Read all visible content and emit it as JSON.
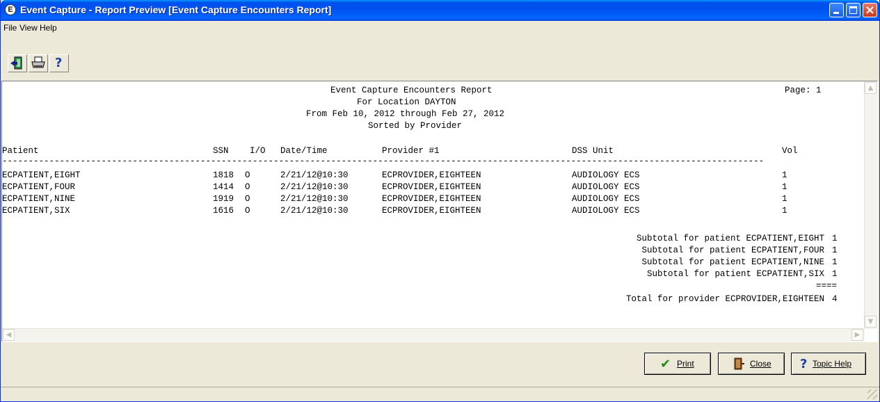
{
  "window": {
    "title": "Event Capture - Report Preview [Event Capture Encounters Report]",
    "app_icon_glyph": "E"
  },
  "menu": [
    "File",
    "View",
    "Help"
  ],
  "toolbar": {
    "buttons": [
      "exit-icon",
      "print-icon",
      "help-icon"
    ],
    "help_glyph": "?"
  },
  "report": {
    "header_lines": [
      "Event Capture Encounters Report",
      "For Location DAYTON",
      "From Feb 10, 2012 through Feb 27, 2012",
      "Sorted by Provider"
    ],
    "page_label": "Page: 1",
    "columns": [
      "Patient",
      "SSN",
      "I/O",
      "Date/Time",
      "Provider #1",
      "DSS Unit",
      "Vol"
    ],
    "rule": "--------------------------------------------------------------------------------------------------------------------------------------------------",
    "rows": [
      [
        "ECPATIENT,EIGHT",
        "1818",
        "O",
        "2/21/12@10:30",
        "ECPROVIDER,EIGHTEEN",
        "AUDIOLOGY ECS",
        "1"
      ],
      [
        "ECPATIENT,FOUR",
        "1414",
        "O",
        "2/21/12@10:30",
        "ECPROVIDER,EIGHTEEN",
        "AUDIOLOGY ECS",
        "1"
      ],
      [
        "ECPATIENT,NINE",
        "1919",
        "O",
        "2/21/12@10:30",
        "ECPROVIDER,EIGHTEEN",
        "AUDIOLOGY ECS",
        "1"
      ],
      [
        "ECPATIENT,SIX",
        "1616",
        "O",
        "2/21/12@10:30",
        "ECPROVIDER,EIGHTEEN",
        "AUDIOLOGY ECS",
        "1"
      ]
    ],
    "subtotals": [
      {
        "label": "Subtotal for patient ECPATIENT,EIGHT",
        "value": "1"
      },
      {
        "label": "Subtotal for patient ECPATIENT,FOUR",
        "value": "1"
      },
      {
        "label": "Subtotal for patient ECPATIENT,NINE",
        "value": "1"
      },
      {
        "label": "Subtotal for patient ECPATIENT,SIX",
        "value": "1"
      }
    ],
    "double_rule": "====",
    "total": {
      "label": "Total for provider ECPROVIDER,EIGHTEEN",
      "value": "4"
    }
  },
  "buttons": {
    "print": {
      "label": "Print",
      "icon": "checkmark-icon",
      "glyph": "✔",
      "color": "#1E8A1E"
    },
    "close": {
      "label": "Close",
      "icon": "door-exit-icon"
    },
    "topic_help": {
      "label": "Topic Help",
      "icon": "question-icon",
      "glyph": "?",
      "color": "#1F3FA8"
    }
  },
  "colors": {
    "title_bar": "#0055EA",
    "face": "#ECE9D8"
  }
}
